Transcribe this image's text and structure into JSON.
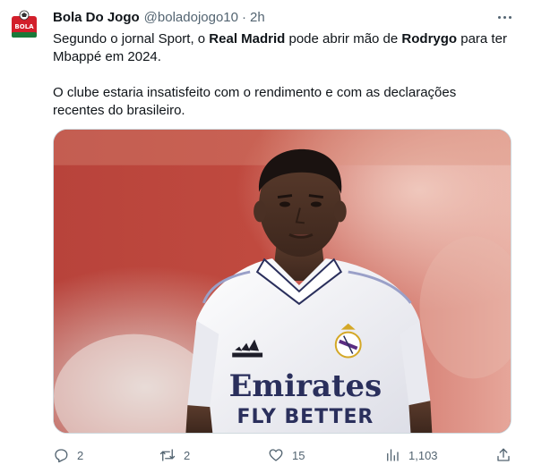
{
  "tweet": {
    "author_name": "Bola Do Jogo",
    "handle": "@boladojogo10",
    "separator": "·",
    "time": "2h",
    "text": {
      "p1_a": "Segundo o jornal Sport, o ",
      "p1_b": "Real Madrid",
      "p1_c": " pode abrir mão de ",
      "p1_d": "Rodrygo",
      "p1_e": " para ter Mbappé em 2024.",
      "p2": "O clube estaria insatisfeito com o rendimento e com as declarações recentes do brasileiro."
    },
    "media": {
      "shirt_sponsor_line1": "Emirates",
      "shirt_sponsor_line2": "FLY BETTER"
    },
    "actions": {
      "reply_count": "2",
      "retweet_count": "2",
      "like_count": "15",
      "views_count": "1,103"
    },
    "avatar_text": "BOLA"
  },
  "colors": {
    "text_primary": "#0f1419",
    "text_secondary": "#536471",
    "border": "#cfd9de",
    "avatar_red": "#d21f2b",
    "avatar_green": "#1a7a3a"
  },
  "icons": [
    "more-icon",
    "reply-icon",
    "retweet-icon",
    "like-icon",
    "views-icon",
    "share-icon"
  ]
}
